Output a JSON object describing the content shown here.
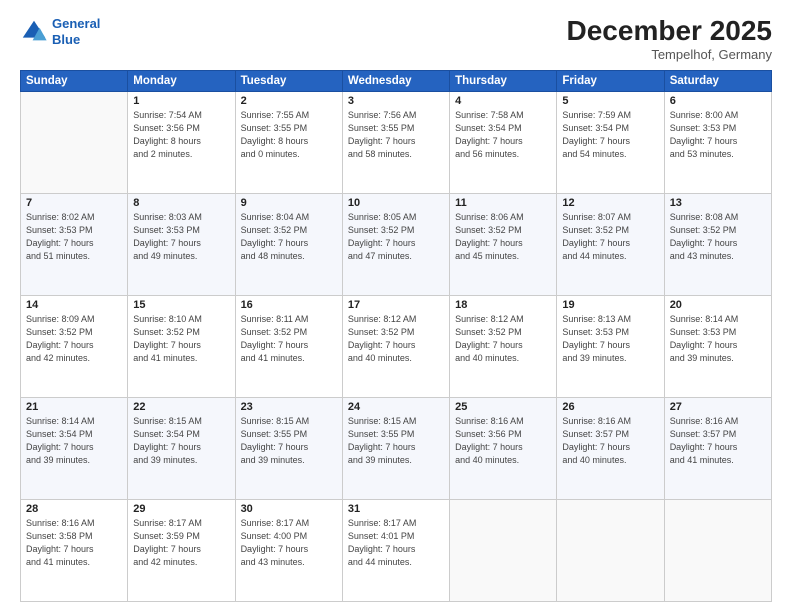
{
  "logo": {
    "line1": "General",
    "line2": "Blue"
  },
  "title": "December 2025",
  "subtitle": "Tempelhof, Germany",
  "days_header": [
    "Sunday",
    "Monday",
    "Tuesday",
    "Wednesday",
    "Thursday",
    "Friday",
    "Saturday"
  ],
  "weeks": [
    [
      {
        "day": "",
        "info": ""
      },
      {
        "day": "1",
        "info": "Sunrise: 7:54 AM\nSunset: 3:56 PM\nDaylight: 8 hours\nand 2 minutes."
      },
      {
        "day": "2",
        "info": "Sunrise: 7:55 AM\nSunset: 3:55 PM\nDaylight: 8 hours\nand 0 minutes."
      },
      {
        "day": "3",
        "info": "Sunrise: 7:56 AM\nSunset: 3:55 PM\nDaylight: 7 hours\nand 58 minutes."
      },
      {
        "day": "4",
        "info": "Sunrise: 7:58 AM\nSunset: 3:54 PM\nDaylight: 7 hours\nand 56 minutes."
      },
      {
        "day": "5",
        "info": "Sunrise: 7:59 AM\nSunset: 3:54 PM\nDaylight: 7 hours\nand 54 minutes."
      },
      {
        "day": "6",
        "info": "Sunrise: 8:00 AM\nSunset: 3:53 PM\nDaylight: 7 hours\nand 53 minutes."
      }
    ],
    [
      {
        "day": "7",
        "info": "Sunrise: 8:02 AM\nSunset: 3:53 PM\nDaylight: 7 hours\nand 51 minutes."
      },
      {
        "day": "8",
        "info": "Sunrise: 8:03 AM\nSunset: 3:53 PM\nDaylight: 7 hours\nand 49 minutes."
      },
      {
        "day": "9",
        "info": "Sunrise: 8:04 AM\nSunset: 3:52 PM\nDaylight: 7 hours\nand 48 minutes."
      },
      {
        "day": "10",
        "info": "Sunrise: 8:05 AM\nSunset: 3:52 PM\nDaylight: 7 hours\nand 47 minutes."
      },
      {
        "day": "11",
        "info": "Sunrise: 8:06 AM\nSunset: 3:52 PM\nDaylight: 7 hours\nand 45 minutes."
      },
      {
        "day": "12",
        "info": "Sunrise: 8:07 AM\nSunset: 3:52 PM\nDaylight: 7 hours\nand 44 minutes."
      },
      {
        "day": "13",
        "info": "Sunrise: 8:08 AM\nSunset: 3:52 PM\nDaylight: 7 hours\nand 43 minutes."
      }
    ],
    [
      {
        "day": "14",
        "info": "Sunrise: 8:09 AM\nSunset: 3:52 PM\nDaylight: 7 hours\nand 42 minutes."
      },
      {
        "day": "15",
        "info": "Sunrise: 8:10 AM\nSunset: 3:52 PM\nDaylight: 7 hours\nand 41 minutes."
      },
      {
        "day": "16",
        "info": "Sunrise: 8:11 AM\nSunset: 3:52 PM\nDaylight: 7 hours\nand 41 minutes."
      },
      {
        "day": "17",
        "info": "Sunrise: 8:12 AM\nSunset: 3:52 PM\nDaylight: 7 hours\nand 40 minutes."
      },
      {
        "day": "18",
        "info": "Sunrise: 8:12 AM\nSunset: 3:52 PM\nDaylight: 7 hours\nand 40 minutes."
      },
      {
        "day": "19",
        "info": "Sunrise: 8:13 AM\nSunset: 3:53 PM\nDaylight: 7 hours\nand 39 minutes."
      },
      {
        "day": "20",
        "info": "Sunrise: 8:14 AM\nSunset: 3:53 PM\nDaylight: 7 hours\nand 39 minutes."
      }
    ],
    [
      {
        "day": "21",
        "info": "Sunrise: 8:14 AM\nSunset: 3:54 PM\nDaylight: 7 hours\nand 39 minutes."
      },
      {
        "day": "22",
        "info": "Sunrise: 8:15 AM\nSunset: 3:54 PM\nDaylight: 7 hours\nand 39 minutes."
      },
      {
        "day": "23",
        "info": "Sunrise: 8:15 AM\nSunset: 3:55 PM\nDaylight: 7 hours\nand 39 minutes."
      },
      {
        "day": "24",
        "info": "Sunrise: 8:15 AM\nSunset: 3:55 PM\nDaylight: 7 hours\nand 39 minutes."
      },
      {
        "day": "25",
        "info": "Sunrise: 8:16 AM\nSunset: 3:56 PM\nDaylight: 7 hours\nand 40 minutes."
      },
      {
        "day": "26",
        "info": "Sunrise: 8:16 AM\nSunset: 3:57 PM\nDaylight: 7 hours\nand 40 minutes."
      },
      {
        "day": "27",
        "info": "Sunrise: 8:16 AM\nSunset: 3:57 PM\nDaylight: 7 hours\nand 41 minutes."
      }
    ],
    [
      {
        "day": "28",
        "info": "Sunrise: 8:16 AM\nSunset: 3:58 PM\nDaylight: 7 hours\nand 41 minutes."
      },
      {
        "day": "29",
        "info": "Sunrise: 8:17 AM\nSunset: 3:59 PM\nDaylight: 7 hours\nand 42 minutes."
      },
      {
        "day": "30",
        "info": "Sunrise: 8:17 AM\nSunset: 4:00 PM\nDaylight: 7 hours\nand 43 minutes."
      },
      {
        "day": "31",
        "info": "Sunrise: 8:17 AM\nSunset: 4:01 PM\nDaylight: 7 hours\nand 44 minutes."
      },
      {
        "day": "",
        "info": ""
      },
      {
        "day": "",
        "info": ""
      },
      {
        "day": "",
        "info": ""
      }
    ]
  ]
}
